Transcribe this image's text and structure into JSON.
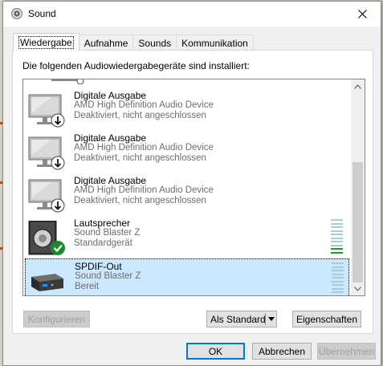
{
  "window": {
    "title": "Sound",
    "close_icon": "close-icon"
  },
  "tabs": [
    {
      "label": "Wiedergabe",
      "active": true
    },
    {
      "label": "Aufnahme"
    },
    {
      "label": "Sounds"
    },
    {
      "label": "Kommunikation"
    }
  ],
  "panel": {
    "description": "Die folgenden Audiowiedergabegeräte sind installiert:"
  },
  "devices": [
    {
      "name": "Digitale Ausgabe",
      "driver": "AMD High Definition Audio Device",
      "status": "Deaktiviert, nicht angeschlossen",
      "icon": "monitor-icon",
      "badge": "down-arrow-icon"
    },
    {
      "name": "Digitale Ausgabe",
      "driver": "AMD High Definition Audio Device",
      "status": "Deaktiviert, nicht angeschlossen",
      "icon": "monitor-icon",
      "badge": "down-arrow-icon"
    },
    {
      "name": "Digitale Ausgabe",
      "driver": "AMD High Definition Audio Device",
      "status": "Deaktiviert, nicht angeschlossen",
      "icon": "monitor-icon",
      "badge": "down-arrow-icon"
    },
    {
      "name": "Lautsprecher",
      "driver": "Sound Blaster Z",
      "status": "Standardgerät",
      "icon": "speaker-icon",
      "badge": "checkmark-icon",
      "level": 0.15
    },
    {
      "name": "SPDIF-Out",
      "driver": "Sound Blaster Z",
      "status": "Bereit",
      "icon": "spdif-device-icon",
      "selected": true,
      "level": 0
    }
  ],
  "buttons": {
    "configure": "Konfigurieren",
    "set_default": "Als Standard",
    "properties": "Eigenschaften",
    "ok": "OK",
    "cancel": "Abbrechen",
    "apply": "Übernehmen"
  },
  "colors": {
    "selection": "#cce8ff",
    "accent": "#0078d7",
    "meter_active": "#1e9e2a",
    "meter_idle": "#a4cfd9"
  }
}
